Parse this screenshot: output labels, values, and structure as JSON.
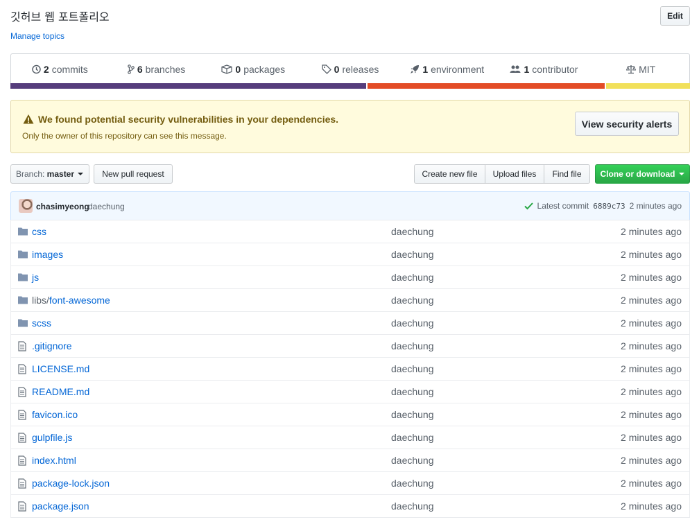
{
  "repo": {
    "description": "깃허브 웹 포트폴리오",
    "manage_topics": "Manage topics",
    "edit_label": "Edit"
  },
  "summary": {
    "items": [
      {
        "icon": "history-icon",
        "count": "2",
        "label": "commits"
      },
      {
        "icon": "branch-icon",
        "count": "6",
        "label": "branches"
      },
      {
        "icon": "package-icon",
        "count": "0",
        "label": "packages"
      },
      {
        "icon": "tag-icon",
        "count": "0",
        "label": "releases"
      },
      {
        "icon": "rocket-icon",
        "count": "1",
        "label": "environment"
      },
      {
        "icon": "people-icon",
        "count": "1",
        "label": "contributor"
      },
      {
        "icon": "law-icon",
        "count": "",
        "label": "MIT"
      }
    ],
    "languages": [
      {
        "color": "#563d7c",
        "fraction": 0.525
      },
      {
        "color": "#e34c26",
        "fraction": 0.352
      },
      {
        "color": "#f1e05a",
        "fraction": 0.123
      }
    ]
  },
  "security_alert": {
    "title": "We found potential security vulnerabilities in your dependencies.",
    "subtitle": "Only the owner of this repository can see this message.",
    "button": "View security alerts"
  },
  "toolbar": {
    "branch_prefix": "Branch:",
    "branch_name": "master",
    "new_pr": "New pull request",
    "create_file": "Create new file",
    "upload_files": "Upload files",
    "find_file": "Find file",
    "clone": "Clone or download"
  },
  "latest_commit": {
    "author": "chasimyeong",
    "message": "daechung",
    "label": "Latest commit",
    "sha": "6889c73",
    "time": "2 minutes ago"
  },
  "files": [
    {
      "type": "dir",
      "prefix": "",
      "name": "css",
      "message": "daechung",
      "age": "2 minutes ago"
    },
    {
      "type": "dir",
      "prefix": "",
      "name": "images",
      "message": "daechung",
      "age": "2 minutes ago"
    },
    {
      "type": "dir",
      "prefix": "",
      "name": "js",
      "message": "daechung",
      "age": "2 minutes ago"
    },
    {
      "type": "dir",
      "prefix": "libs/",
      "name": "font-awesome",
      "message": "daechung",
      "age": "2 minutes ago"
    },
    {
      "type": "dir",
      "prefix": "",
      "name": "scss",
      "message": "daechung",
      "age": "2 minutes ago"
    },
    {
      "type": "file",
      "prefix": "",
      "name": ".gitignore",
      "message": "daechung",
      "age": "2 minutes ago"
    },
    {
      "type": "file",
      "prefix": "",
      "name": "LICENSE.md",
      "message": "daechung",
      "age": "2 minutes ago"
    },
    {
      "type": "file",
      "prefix": "",
      "name": "README.md",
      "message": "daechung",
      "age": "2 minutes ago"
    },
    {
      "type": "file",
      "prefix": "",
      "name": "favicon.ico",
      "message": "daechung",
      "age": "2 minutes ago"
    },
    {
      "type": "file",
      "prefix": "",
      "name": "gulpfile.js",
      "message": "daechung",
      "age": "2 minutes ago"
    },
    {
      "type": "file",
      "prefix": "",
      "name": "index.html",
      "message": "daechung",
      "age": "2 minutes ago"
    },
    {
      "type": "file",
      "prefix": "",
      "name": "package-lock.json",
      "message": "daechung",
      "age": "2 minutes ago"
    },
    {
      "type": "file",
      "prefix": "",
      "name": "package.json",
      "message": "daechung",
      "age": "2 minutes ago"
    }
  ]
}
